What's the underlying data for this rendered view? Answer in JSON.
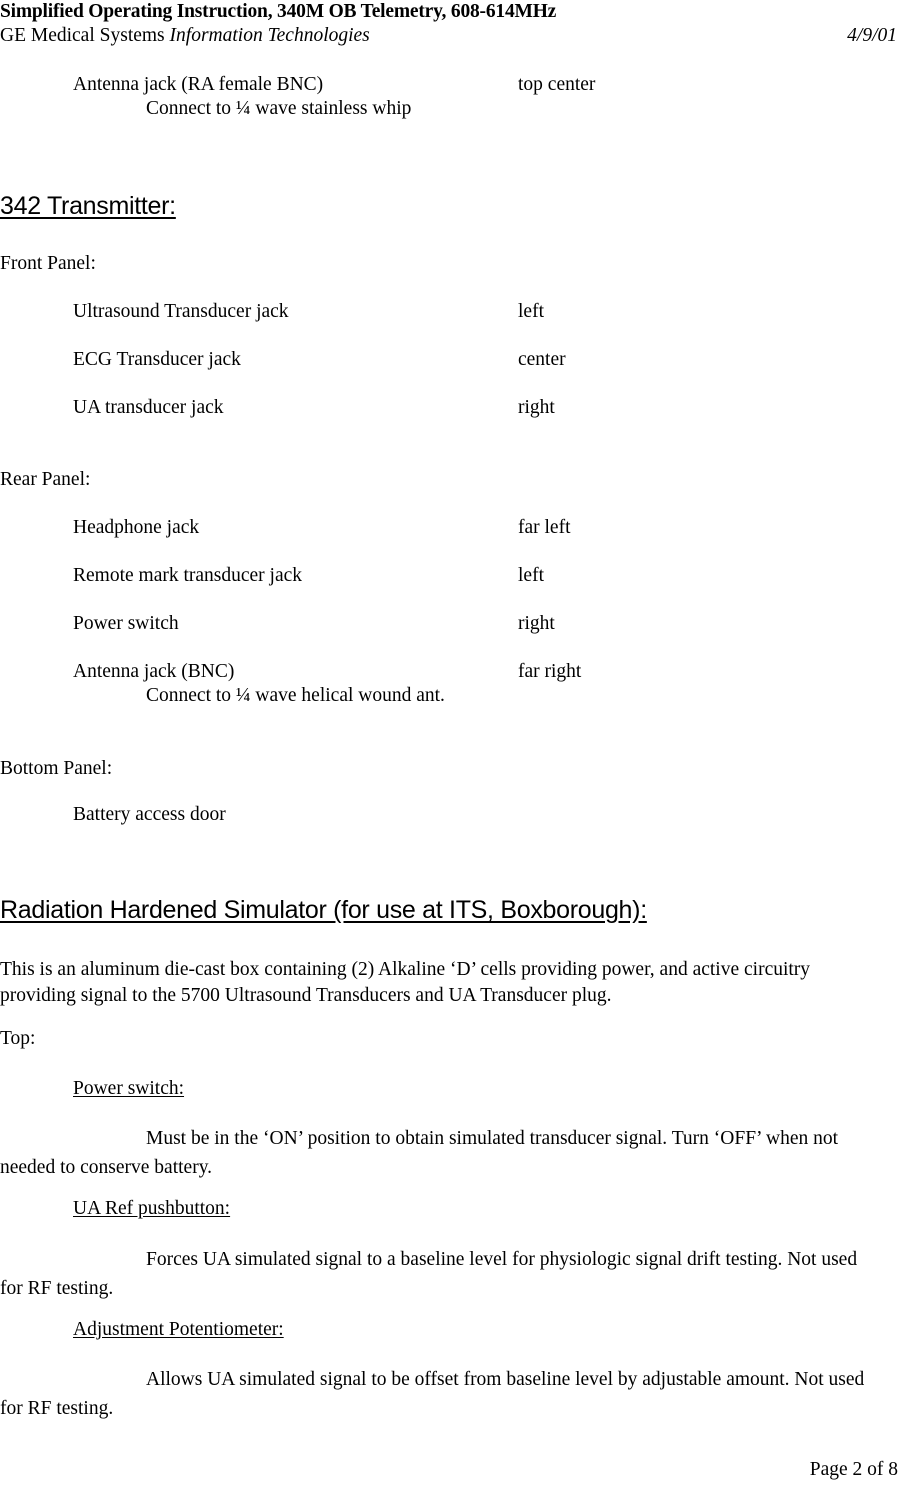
{
  "header": {
    "title": "Simplified Operating Instruction, 340M OB Telemetry, 608-614MHz",
    "org": "GE Medical Systems ",
    "org_italic": "Information Technologies",
    "date": "4/9/01"
  },
  "continued_item": {
    "label": "Antenna jack (RA female BNC)",
    "value": "top center",
    "note": "Connect to ¼ wave stainless whip"
  },
  "transmitter": {
    "heading": "342 Transmitter:",
    "front_panel_label": "Front Panel:",
    "front_panel_items": [
      {
        "label": "Ultrasound Transducer jack",
        "value": "left"
      },
      {
        "label": "ECG Transducer jack",
        "value": "center"
      },
      {
        "label": "UA transducer jack",
        "value": "right"
      }
    ],
    "rear_panel_label": "Rear Panel:",
    "rear_panel_items": [
      {
        "label": "Headphone jack",
        "value": "far left"
      },
      {
        "label": "Remote mark transducer jack",
        "value": "left"
      },
      {
        "label": "Power switch",
        "value": "right"
      },
      {
        "label": "Antenna jack (BNC)",
        "value": "far right"
      }
    ],
    "rear_panel_note": "Connect to ¼ wave helical wound ant.",
    "bottom_panel_label": "Bottom Panel:",
    "bottom_panel_items": [
      {
        "label": "Battery access door",
        "value": ""
      }
    ]
  },
  "simulator": {
    "heading": "Radiation Hardened Simulator  (for use at ITS, Boxborough):",
    "intro": "This is an aluminum die-cast box containing (2) Alkaline ‘D’ cells providing power, and active circuitry providing signal to the 5700 Ultrasound Transducers and UA Transducer plug.",
    "top_label": "Top:",
    "controls": [
      {
        "name": "Power switch:",
        "description": "Must be in the ‘ON’ position to obtain simulated transducer signal. Turn ‘OFF’ when not needed to conserve battery."
      },
      {
        "name": "UA Ref pushbutton:",
        "description": "Forces UA simulated signal to a baseline level for physiologic signal drift testing. Not used for RF testing."
      },
      {
        "name": "Adjustment Potentiometer:",
        "description": "Allows UA simulated signal to be offset from baseline level by adjustable amount. Not used for RF testing."
      }
    ]
  },
  "footer": {
    "page_number": "Page 2 of 8"
  }
}
